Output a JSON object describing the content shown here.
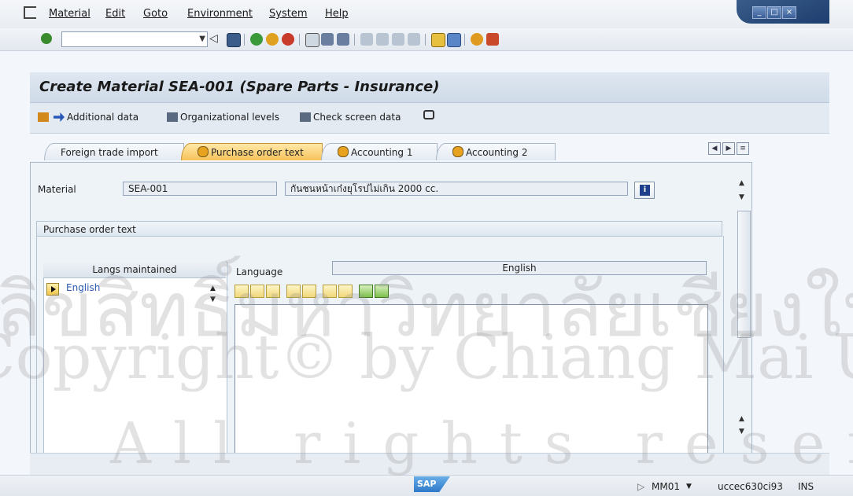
{
  "menubar": {
    "items": [
      "Material",
      "Edit",
      "Goto",
      "Environment",
      "System",
      "Help"
    ]
  },
  "toolbar": {
    "command_value": "",
    "icons": [
      "enter-icon",
      "back-icon",
      "save-icon",
      "back-nav-icon",
      "exit-icon",
      "cancel-icon",
      "print-icon",
      "find-icon",
      "find-next-icon",
      "first-page-icon",
      "prev-page-icon",
      "next-page-icon",
      "last-page-icon",
      "new-session-icon",
      "shortcut-icon",
      "help-icon",
      "layout-icon"
    ]
  },
  "header": {
    "title": "Create Material SEA-001 (Spare Parts - Insurance)"
  },
  "app_toolbar": {
    "additional_data": "Additional data",
    "org_levels": "Organizational levels",
    "check_screen": "Check screen data"
  },
  "tabs": [
    {
      "label": "Foreign trade import",
      "active": false
    },
    {
      "label": "Purchase order text",
      "active": true
    },
    {
      "label": "Accounting 1",
      "active": false
    },
    {
      "label": "Accounting 2",
      "active": false
    }
  ],
  "material": {
    "label": "Material",
    "value": "SEA-001",
    "description": "กันชนหน้าเก๋งยุโรปไม่เกิน 2000 cc."
  },
  "po_text": {
    "group_title": "Purchase order text",
    "langs_header": "Langs maintained",
    "langs": [
      "English"
    ],
    "language_label": "Language",
    "language_value": "English"
  },
  "status_bar": {
    "logo": "SAP",
    "transaction": "MM01",
    "server": "uccec630ci93",
    "mode": "INS"
  },
  "watermark": {
    "line1": "ลิขสิทธิ์มหาวิทยาลัยเชียงใหม่",
    "line2": "Copyright© by Chiang Mai University",
    "line3": "All rights reserved"
  },
  "colors": {
    "title_bg": "#dfe7f1",
    "active_tab": "#f7c25a",
    "link_blue": "#2a5bb0"
  }
}
